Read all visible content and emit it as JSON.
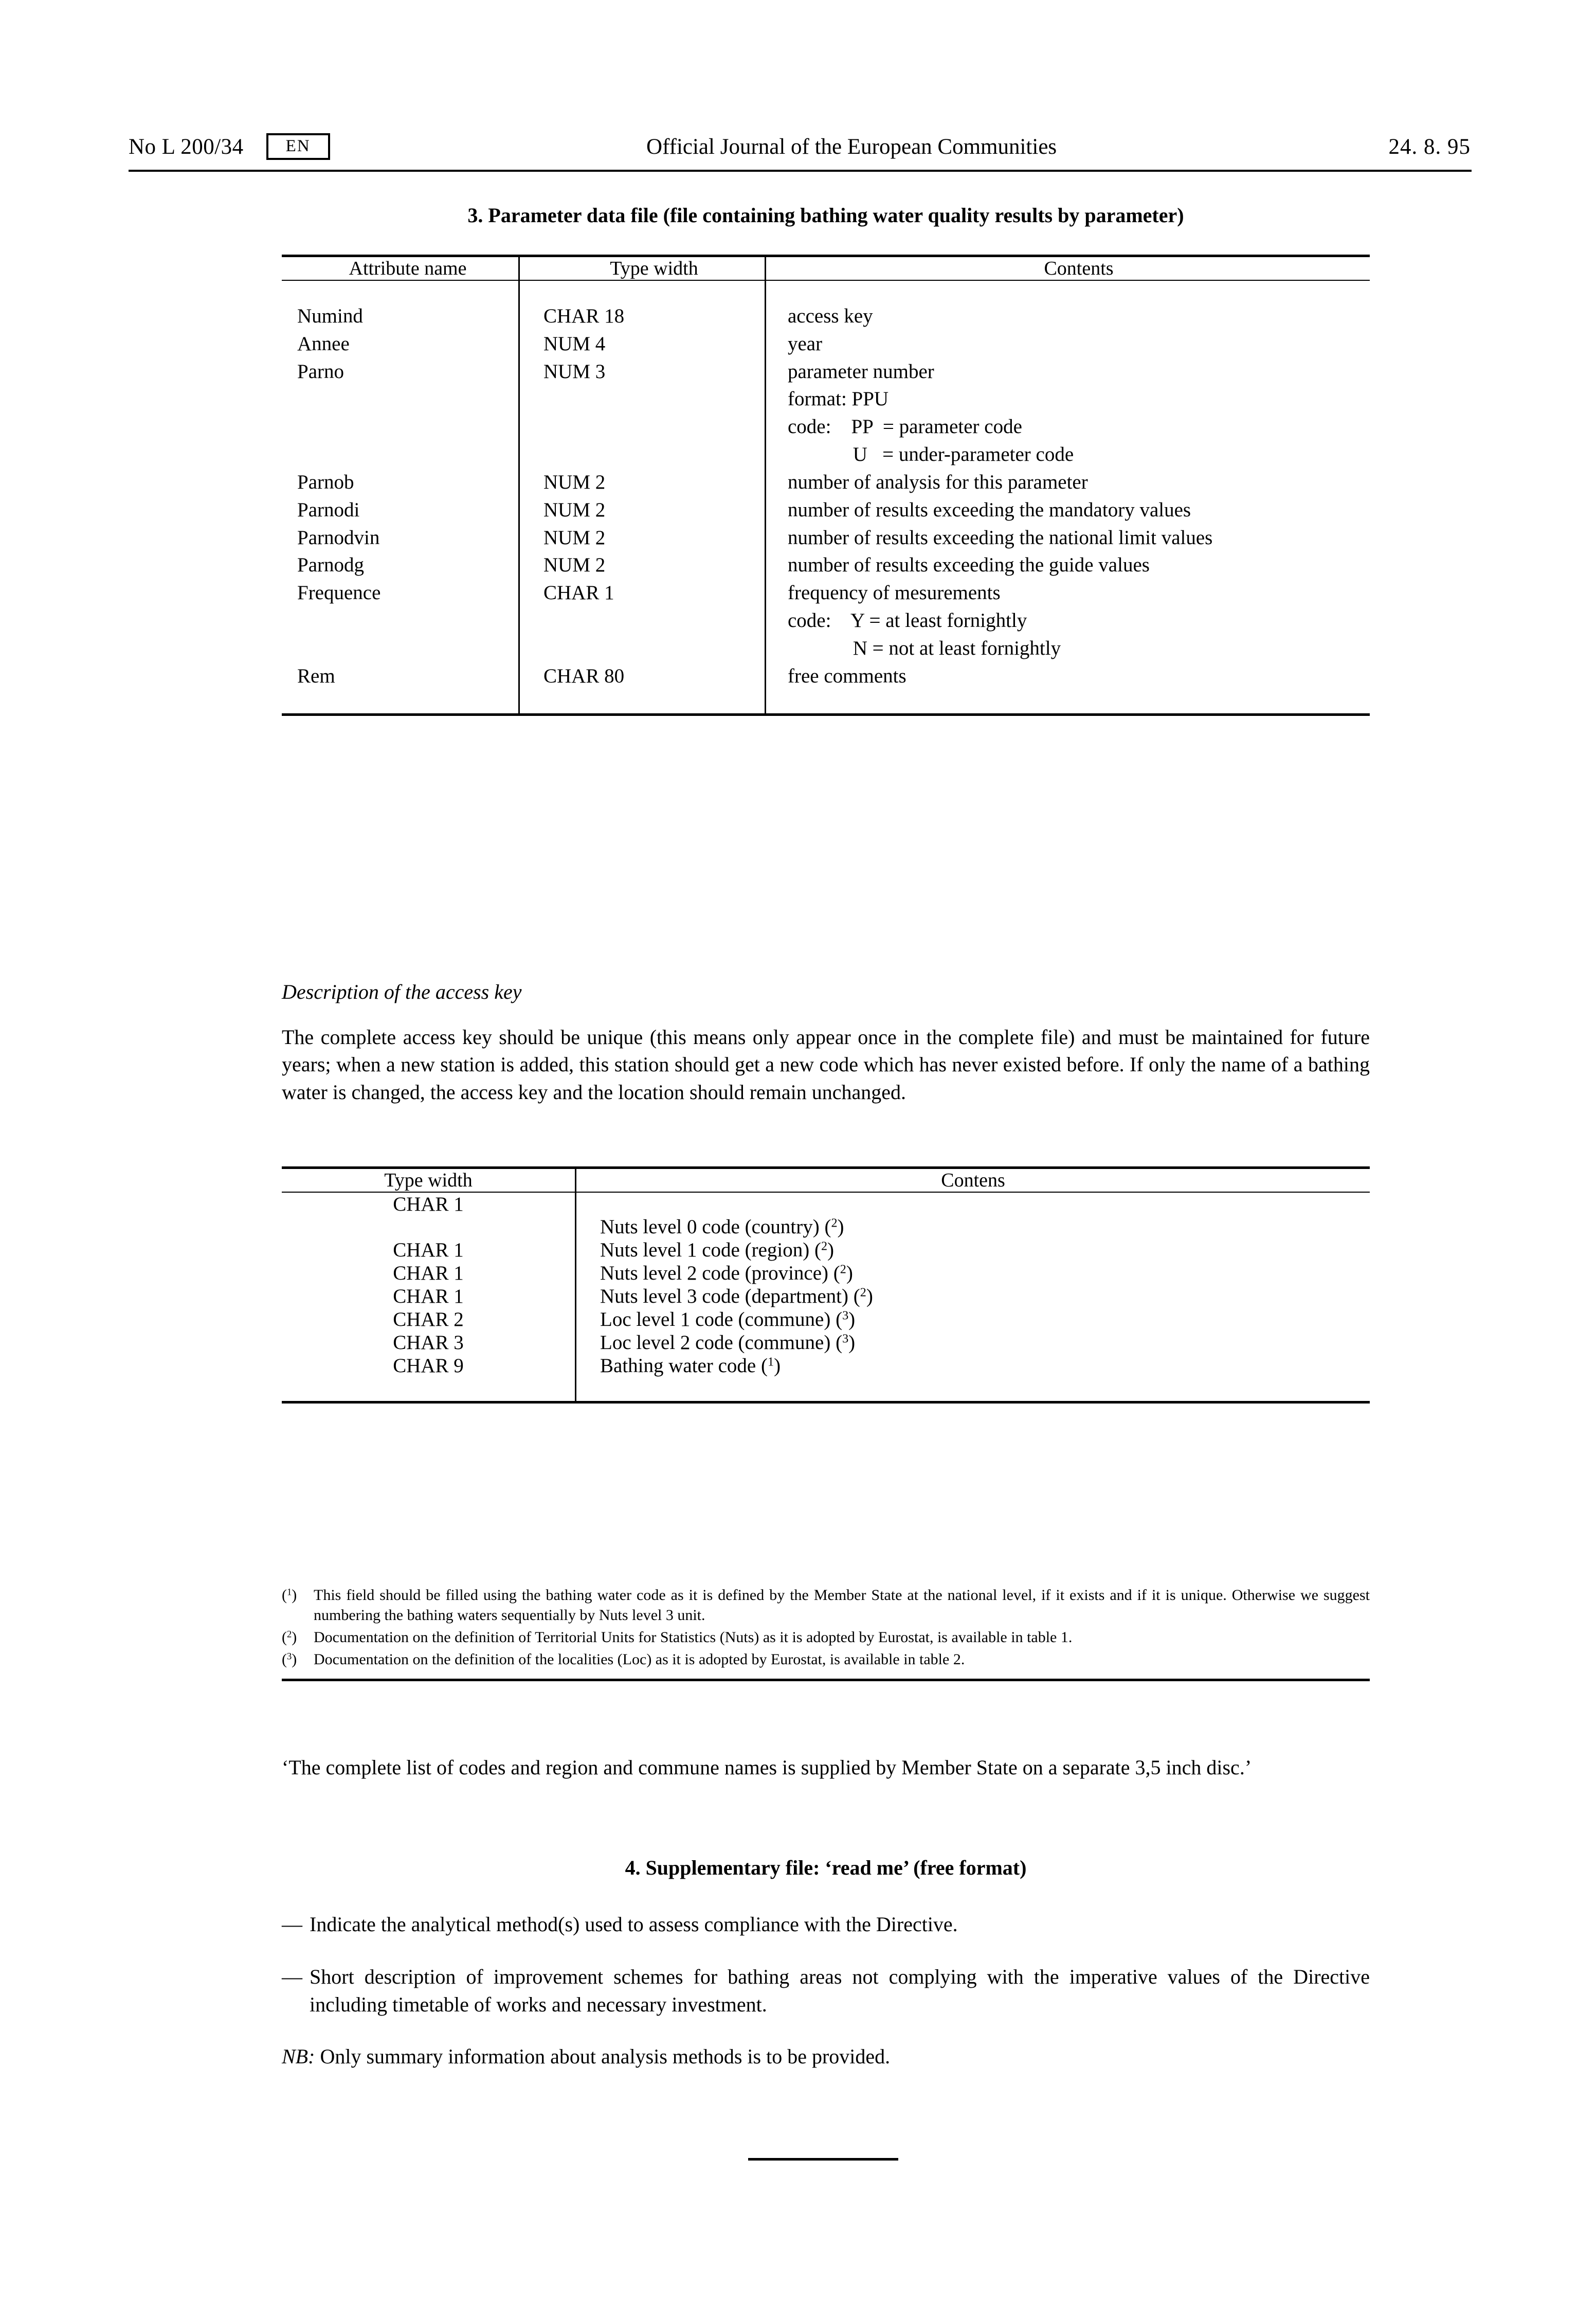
{
  "header": {
    "left_ref": "No L 200/34",
    "language_code": "EN",
    "publication_title": "Official Journal of the European Communities",
    "date": "24. 8. 95"
  },
  "section3": {
    "title": "3. Parameter data file (file containing bathing water quality results by parameter)",
    "table": {
      "columns": [
        "Attribute name",
        "Type width",
        "Contents"
      ],
      "rows": [
        {
          "attribute": "Numind",
          "type": "CHAR 18",
          "contents": "access key"
        },
        {
          "attribute": "Annee",
          "type": "NUM 4",
          "contents": "year"
        },
        {
          "attribute": "Parno",
          "type": "NUM 3",
          "contents": "parameter number",
          "contents_lines": [
            "parameter number",
            "format: PPU",
            "code:    PP  = parameter code",
            "             U   = under-parameter code"
          ]
        },
        {
          "attribute": "Parnob",
          "type": "NUM 2",
          "contents": "number of analysis for this parameter"
        },
        {
          "attribute": "Parnodi",
          "type": "NUM 2",
          "contents": "number of results exceeding the mandatory values"
        },
        {
          "attribute": "Parnodvin",
          "type": "NUM 2",
          "contents": "number of results exceeding the national limit values"
        },
        {
          "attribute": "Parnodg",
          "type": "NUM 2",
          "contents": "number of results exceeding the guide values"
        },
        {
          "attribute": "Frequence",
          "type": "CHAR 1",
          "contents": "frequency of mesurements",
          "contents_lines": [
            "frequency of mesurements",
            "code:    Y = at least fornightly",
            "             N = not at least fornightly"
          ]
        },
        {
          "attribute": "Rem",
          "type": "CHAR 80",
          "contents": "free comments"
        }
      ]
    }
  },
  "access_key": {
    "subhead": "Description of the access key",
    "paragraph": "The complete access key should be unique (this means only appear once in the complete file) and must be maintained for future years; when a new station is added, this station should get a new code which has never existed before. If only the name of a bathing water is changed, the access key and the location should remain unchanged.",
    "table": {
      "columns": [
        "Type width",
        "Contens"
      ],
      "rows": [
        {
          "type": "CHAR 1",
          "contents": "Nuts level 0 code (country)",
          "note": "2"
        },
        {
          "type": "CHAR 1",
          "contents": "Nuts level 1 code (region)",
          "note": "2"
        },
        {
          "type": "CHAR 1",
          "contents": "Nuts level 2 code (province)",
          "note": "2"
        },
        {
          "type": "CHAR 1",
          "contents": "Nuts level 3 code (department)",
          "note": "2"
        },
        {
          "type": "CHAR 2",
          "contents": "Loc level 1 code (commune)",
          "note": "3"
        },
        {
          "type": "CHAR 3",
          "contents": "Loc level 2 code (commune)",
          "note": "3"
        },
        {
          "type": "CHAR 9",
          "contents": "Bathing water code",
          "note": "1"
        }
      ]
    },
    "footnotes": [
      {
        "mark": "(1)",
        "text": "This field should be filled using the bathing water code as it is defined by the Member State at the national level, if it exists and if it is unique. Otherwise we suggest numbering the bathing waters sequentially by Nuts level 3 unit."
      },
      {
        "mark": "(2)",
        "text": "Documentation on the definition of Territorial Units for Statistics (Nuts) as it is adopted by Eurostat, is available in table 1."
      },
      {
        "mark": "(3)",
        "text": "Documentation on the definition of the localities (Loc) as it is adopted by Eurostat, is available in table 2."
      }
    ],
    "closing_note": "‘The complete list of codes and region and commune names is supplied by Member State on a separate 3,5 inch disc.’"
  },
  "section4": {
    "title": "4. Supplementary file: ‘read me’ (free format)",
    "items": [
      {
        "mark": "—",
        "text": "Indicate the analytical method(s) used to assess compliance with the Directive."
      },
      {
        "mark": "—",
        "text": "Short description of improvement schemes for bathing areas not complying with the imperative values of the Directive including timetable of works and necessary investment."
      }
    ],
    "nb_label": "NB:",
    "nb_text": "Only summary information about analysis methods is to be provided."
  }
}
